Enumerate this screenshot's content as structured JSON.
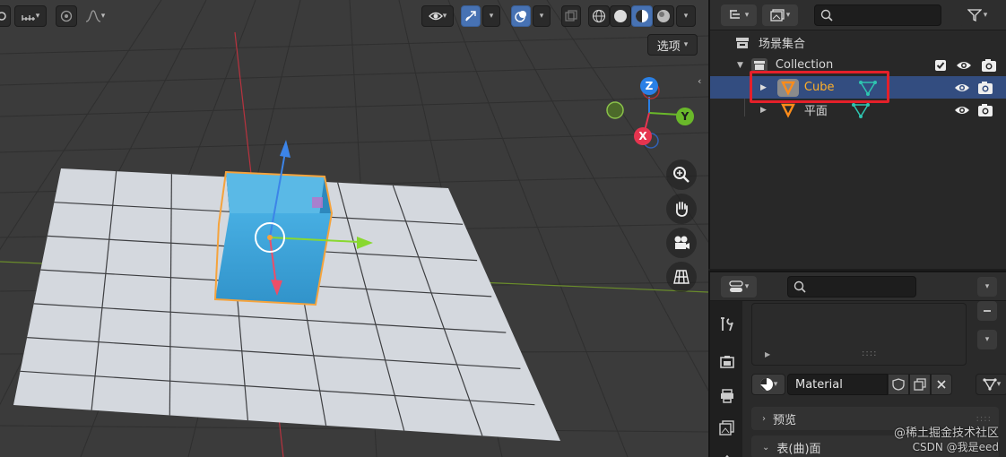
{
  "viewport": {
    "select_menu_label": "选项"
  },
  "outliner": {
    "scene_collection_label": "场景集合",
    "items": [
      {
        "name": "Collection",
        "type": "collection",
        "expanded": true
      },
      {
        "name": "Cube",
        "type": "mesh",
        "selected": true
      },
      {
        "name": "平面",
        "type": "mesh",
        "selected": false
      }
    ]
  },
  "properties": {
    "material_name": "Material",
    "panels": [
      {
        "label": "预览",
        "expanded": false
      },
      {
        "label": "表(曲)面",
        "expanded": true
      }
    ]
  },
  "watermark": {
    "line1": "@稀土掘金技术社区",
    "line2": "CSDN @我是eed"
  },
  "colors": {
    "accent_selected_row": "#334d80",
    "active_object_text": "#ffaf29",
    "highlight_box": "#e5202a",
    "cube_blue": "#3a9fd6",
    "gizmo_z": "#2a80e6",
    "gizmo_y": "#6ab82a",
    "gizmo_x": "#e6344f"
  }
}
